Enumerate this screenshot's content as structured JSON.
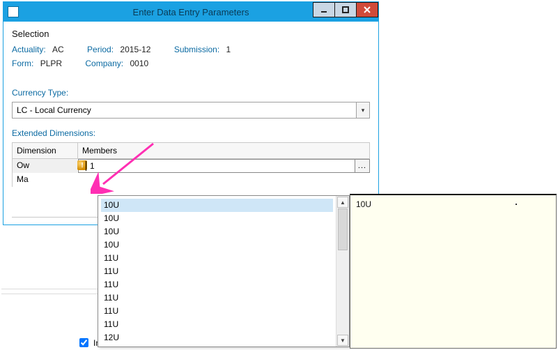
{
  "window": {
    "title": "Enter Data Entry Parameters"
  },
  "selection": {
    "heading": "Selection",
    "actuality_label": "Actuality:",
    "actuality_value": "AC",
    "period_label": "Period:",
    "period_value": "2015-12",
    "submission_label": "Submission:",
    "submission_value": "1",
    "form_label": "Form:",
    "form_value": "PLPR",
    "company_label": "Company:",
    "company_value": "0010"
  },
  "currency": {
    "label": "Currency Type:",
    "value": "LC - Local Currency"
  },
  "extdim": {
    "label": "Extended Dimensions:",
    "col_dimension": "Dimension",
    "col_members": "Members",
    "rows": [
      {
        "dim": "Ow"
      },
      {
        "dim": "Ma"
      }
    ],
    "editor_value": "1",
    "editor_btn": "..."
  },
  "popup": {
    "items": [
      "10U",
      "10U",
      "10U",
      "10U",
      "11U",
      "11U",
      "11U",
      "11U",
      "11U",
      "11U",
      "12U"
    ],
    "selected_index": 0
  },
  "tooltip": {
    "text": "10U"
  },
  "footer": {
    "checkbox_label": "In"
  }
}
